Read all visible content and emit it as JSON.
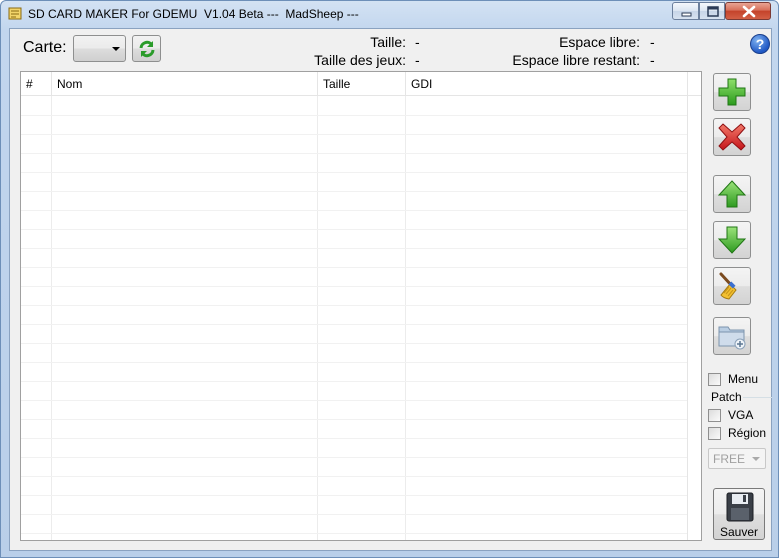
{
  "window": {
    "title": "SD CARD MAKER For GDEMU  V1.04 Beta ---  MadSheep ---",
    "minimize_icon": "minimize-icon",
    "maximize_icon": "maximize-icon",
    "close_icon": "close-icon"
  },
  "toolbar": {
    "carte_label": "Carte:",
    "carte_value": "",
    "refresh_icon": "refresh-icon"
  },
  "info": {
    "taille_label": "Taille:",
    "taille_value": "-",
    "taille_jeux_label": "Taille des jeux:",
    "taille_jeux_value": "-",
    "espace_libre_label": "Espace libre:",
    "espace_libre_value": "-",
    "espace_restant_label": "Espace libre restant:",
    "espace_restant_value": "-"
  },
  "help": {
    "label": "?"
  },
  "table": {
    "columns": [
      "#",
      "Nom",
      "Taille",
      "GDI"
    ],
    "rows": []
  },
  "side_buttons": {
    "add_icon": "plus-icon",
    "remove_icon": "delete-icon",
    "up_icon": "arrow-up-icon",
    "down_icon": "arrow-down-icon",
    "clean_icon": "broom-icon",
    "folder_icon": "folder-add-icon"
  },
  "options": {
    "menu_label": "Menu",
    "patch_label": "Patch",
    "vga_label": "VGA",
    "region_label": "Région",
    "region_value": "FREE"
  },
  "save": {
    "label": "Sauver",
    "icon": "floppy-disk-icon"
  },
  "colors": {
    "title_bg": "#c2d6ee",
    "client_bg": "#f0f0f0",
    "close_red": "#c4432b",
    "accent_green": "#3fae2a",
    "accent_red": "#d9282c"
  }
}
